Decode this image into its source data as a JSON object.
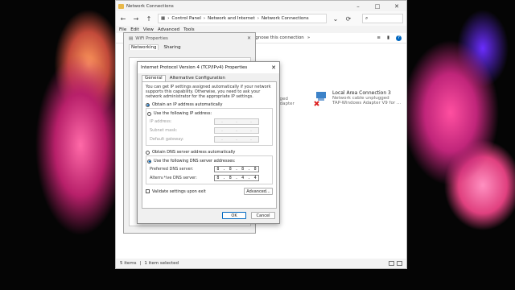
{
  "explorer": {
    "title": "Network Connections",
    "path": [
      "Control Panel",
      "Network and Internet",
      "Network Connections"
    ],
    "menu": [
      "File",
      "Edit",
      "View",
      "Advanced",
      "Tools"
    ],
    "command_item": "agnose this connection",
    "adapters": [
      {
        "name": "",
        "status": "gged",
        "device": "Adapter"
      },
      {
        "name": "Local Area Connection 3",
        "status": "Network cable unplugged",
        "device": "TAP-Windows Adapter V9 for ..."
      }
    ],
    "status": {
      "items": "5 items",
      "selected": "1 item selected"
    }
  },
  "wifi_dialog": {
    "title": "WiFi Properties",
    "tabs": [
      "Networking",
      "Sharing"
    ]
  },
  "ipv4": {
    "title": "Internet Protocol Version 4 (TCP/IPv4) Properties",
    "tabs": [
      "General",
      "Alternative Configuration"
    ],
    "description": "You can get IP settings assigned automatically if your network supports this capability. Otherwise, you need to ask your network administrator for the appropriate IP settings.",
    "obtain_ip_auto": "Obtain an IP address automatically",
    "use_ip": "Use the following IP address:",
    "ip_fields": [
      {
        "label": "IP address:",
        "value": [
          "",
          "",
          "",
          ""
        ]
      },
      {
        "label": "Subnet mask:",
        "value": [
          "",
          "",
          "",
          ""
        ]
      },
      {
        "label": "Default gateway:",
        "value": [
          "",
          "",
          "",
          ""
        ]
      }
    ],
    "obtain_dns_auto": "Obtain DNS server address automatically",
    "use_dns": "Use the following DNS server addresses:",
    "preferred_dns_label": "Preferred DNS server:",
    "preferred_dns": [
      "8",
      "8",
      "8",
      "8"
    ],
    "alternate_dns_label": "Alternative DNS server:",
    "alternate_dns": [
      "8",
      "8",
      "4",
      "4"
    ],
    "validate": "Validate settings upon exit",
    "advanced": "Advanced...",
    "ok": "OK",
    "cancel": "Cancel"
  }
}
